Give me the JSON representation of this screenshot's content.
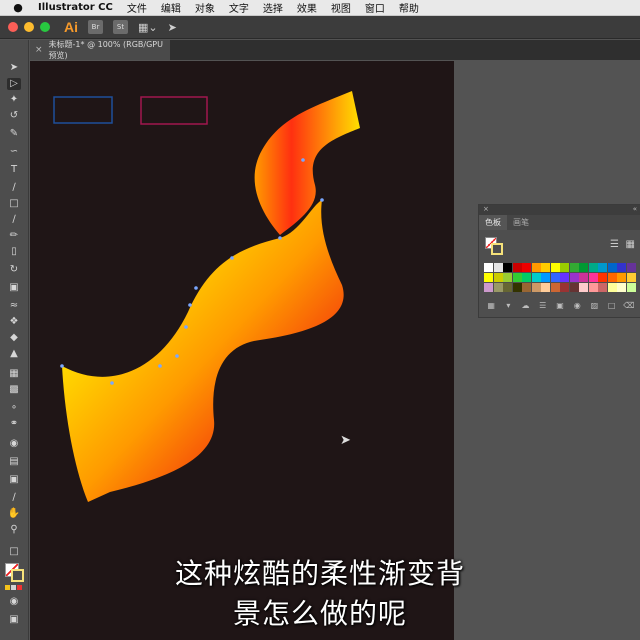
{
  "menubar": {
    "apple_icon": "",
    "app_name": "Illustrator CC",
    "items": [
      "文件",
      "编辑",
      "对象",
      "文字",
      "选择",
      "效果",
      "视图",
      "窗口",
      "帮助"
    ]
  },
  "appbar": {
    "logo": "Ai",
    "br_label": "Br",
    "st_label": "St"
  },
  "document_tab": {
    "close_icon": "×",
    "title": "未标题-1* @ 100% (RGB/GPU 预览)"
  },
  "swatches_panel": {
    "header_close": "×",
    "header_collapse": "«",
    "tabs": [
      "色板",
      "画笔"
    ]
  },
  "subtitles": {
    "line1": "这种炫酷的柔性渐变背",
    "line2": "景怎么做的呢"
  },
  "colors": {
    "gradient_start": "#ffe000",
    "gradient_mid": "#ff9a00",
    "gradient_end": "#ee1010",
    "artboard": "#1f1516",
    "rect_blue": "#1f4f9a",
    "rect_magenta": "#a0174f"
  }
}
